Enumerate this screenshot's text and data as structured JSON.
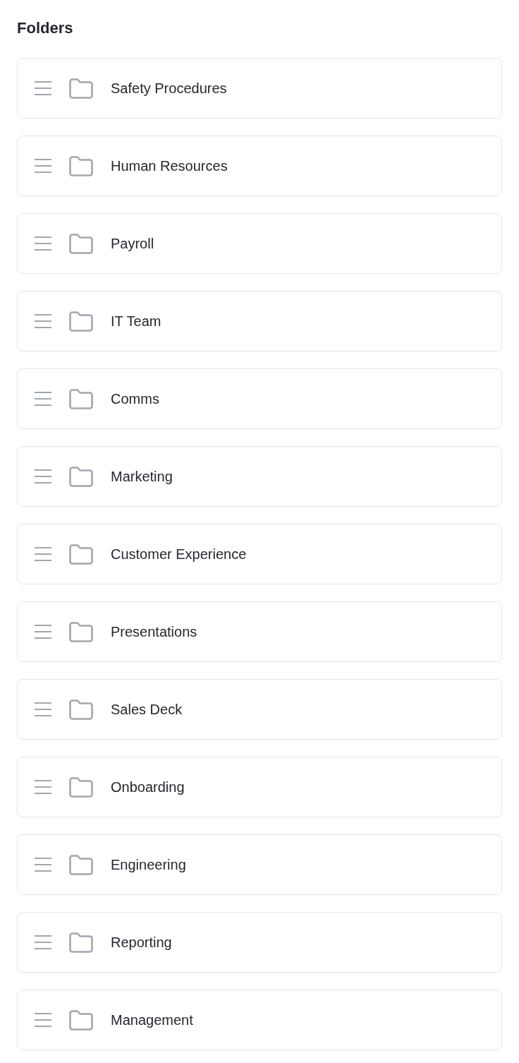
{
  "title": "Folders",
  "folders": [
    {
      "name": "Safety Procedures"
    },
    {
      "name": "Human Resources"
    },
    {
      "name": "Payroll"
    },
    {
      "name": "IT Team"
    },
    {
      "name": "Comms"
    },
    {
      "name": "Marketing"
    },
    {
      "name": "Customer Experience"
    },
    {
      "name": "Presentations"
    },
    {
      "name": "Sales Deck"
    },
    {
      "name": "Onboarding"
    },
    {
      "name": "Engineering"
    },
    {
      "name": "Reporting"
    },
    {
      "name": "Management"
    }
  ]
}
